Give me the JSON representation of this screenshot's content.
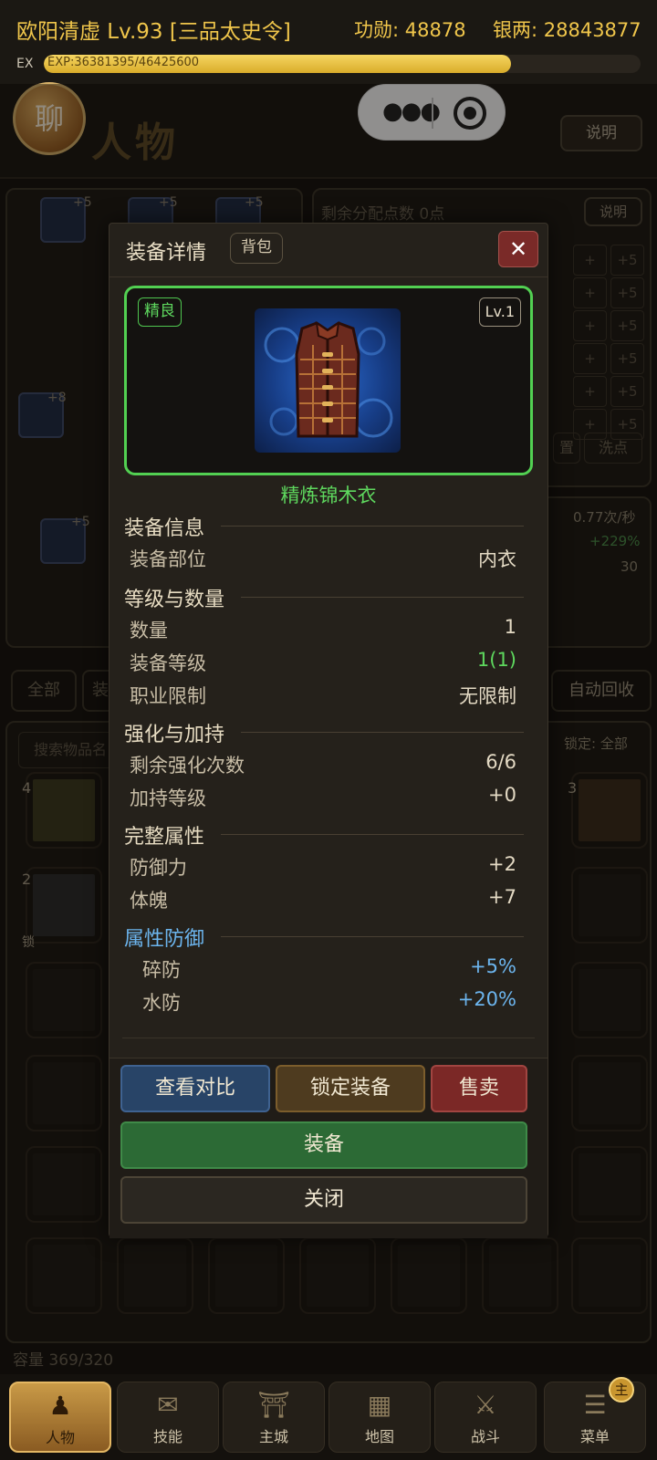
{
  "status": {
    "name_level": "欧阳清虚 Lv.93 [三品太史令]",
    "merit": "功勋: 48878",
    "silver": "银两: 28843877",
    "exp_label": "EX",
    "exp_text": "EXP:36381395/46425600",
    "exp_progress": 0.7836
  },
  "header": {
    "chat_label": "聊",
    "page_title": "人物",
    "explain_label": "说明"
  },
  "capsule": {
    "more_icon": "more-dots-icon",
    "target_icon": "target-icon"
  },
  "background": {
    "points_label": "剩余分配点数 0点",
    "points_explain": "说明",
    "plus_left": "+",
    "plus_right": "+5",
    "reset_label": "置",
    "wash_label": "洗点",
    "rate": "0.77次/秒",
    "percent": "+229%",
    "thirty": "30",
    "left_plus": [
      "+5",
      "+5",
      "+5",
      "+8",
      "+5"
    ],
    "filter_all": "全部",
    "filter_b": "装",
    "auto_recycle": "自动回收",
    "search_placeholder": "搜索物品名",
    "lock_filter": "锁定: 全部",
    "counts": [
      "4",
      "3",
      "2"
    ],
    "lock_mark": "锁",
    "capacity": "容量 369/320"
  },
  "modal": {
    "title": "装备详情",
    "bag_tag": "背包",
    "close_icon": "close-icon",
    "quality": "精良",
    "level": "Lv.1",
    "item_name": "精炼锦木衣",
    "sections": {
      "info": "装备信息",
      "level_qty": "等级与数量",
      "enhance": "强化与加持",
      "attrs": "完整属性",
      "defense": "属性防御"
    },
    "rows": {
      "slot_label": "装备部位",
      "slot_value": "内衣",
      "qty_label": "数量",
      "qty_value": "1",
      "lvl_label": "装备等级",
      "lvl_value": "1(1)",
      "job_label": "职业限制",
      "job_value": "无限制",
      "enh_label": "剩余强化次数",
      "enh_value": "6/6",
      "bless_label": "加持等级",
      "bless_value": "+0",
      "def_label": "防御力",
      "def_value": "+2",
      "phys_label": "体魄",
      "phys_value": "+7",
      "crush_label": "碎防",
      "crush_value": "+5%",
      "water_label": "水防",
      "water_value": "+20%"
    },
    "buttons": {
      "compare": "查看对比",
      "lock": "锁定装备",
      "sell": "售卖",
      "equip": "装备",
      "close": "关闭"
    }
  },
  "nav": [
    {
      "label": "人物",
      "icon": "character-icon"
    },
    {
      "label": "技能",
      "icon": "skill-scroll-icon"
    },
    {
      "label": "主城",
      "icon": "city-icon"
    },
    {
      "label": "地图",
      "icon": "map-icon"
    },
    {
      "label": "战斗",
      "icon": "crossed-swords-icon"
    },
    {
      "label": "菜单",
      "icon": "menu-icon",
      "badge": "主"
    }
  ],
  "colors": {
    "gold": "#f0c64b",
    "quality_green": "#5ed85e",
    "defense_blue": "#6cb5ee"
  }
}
